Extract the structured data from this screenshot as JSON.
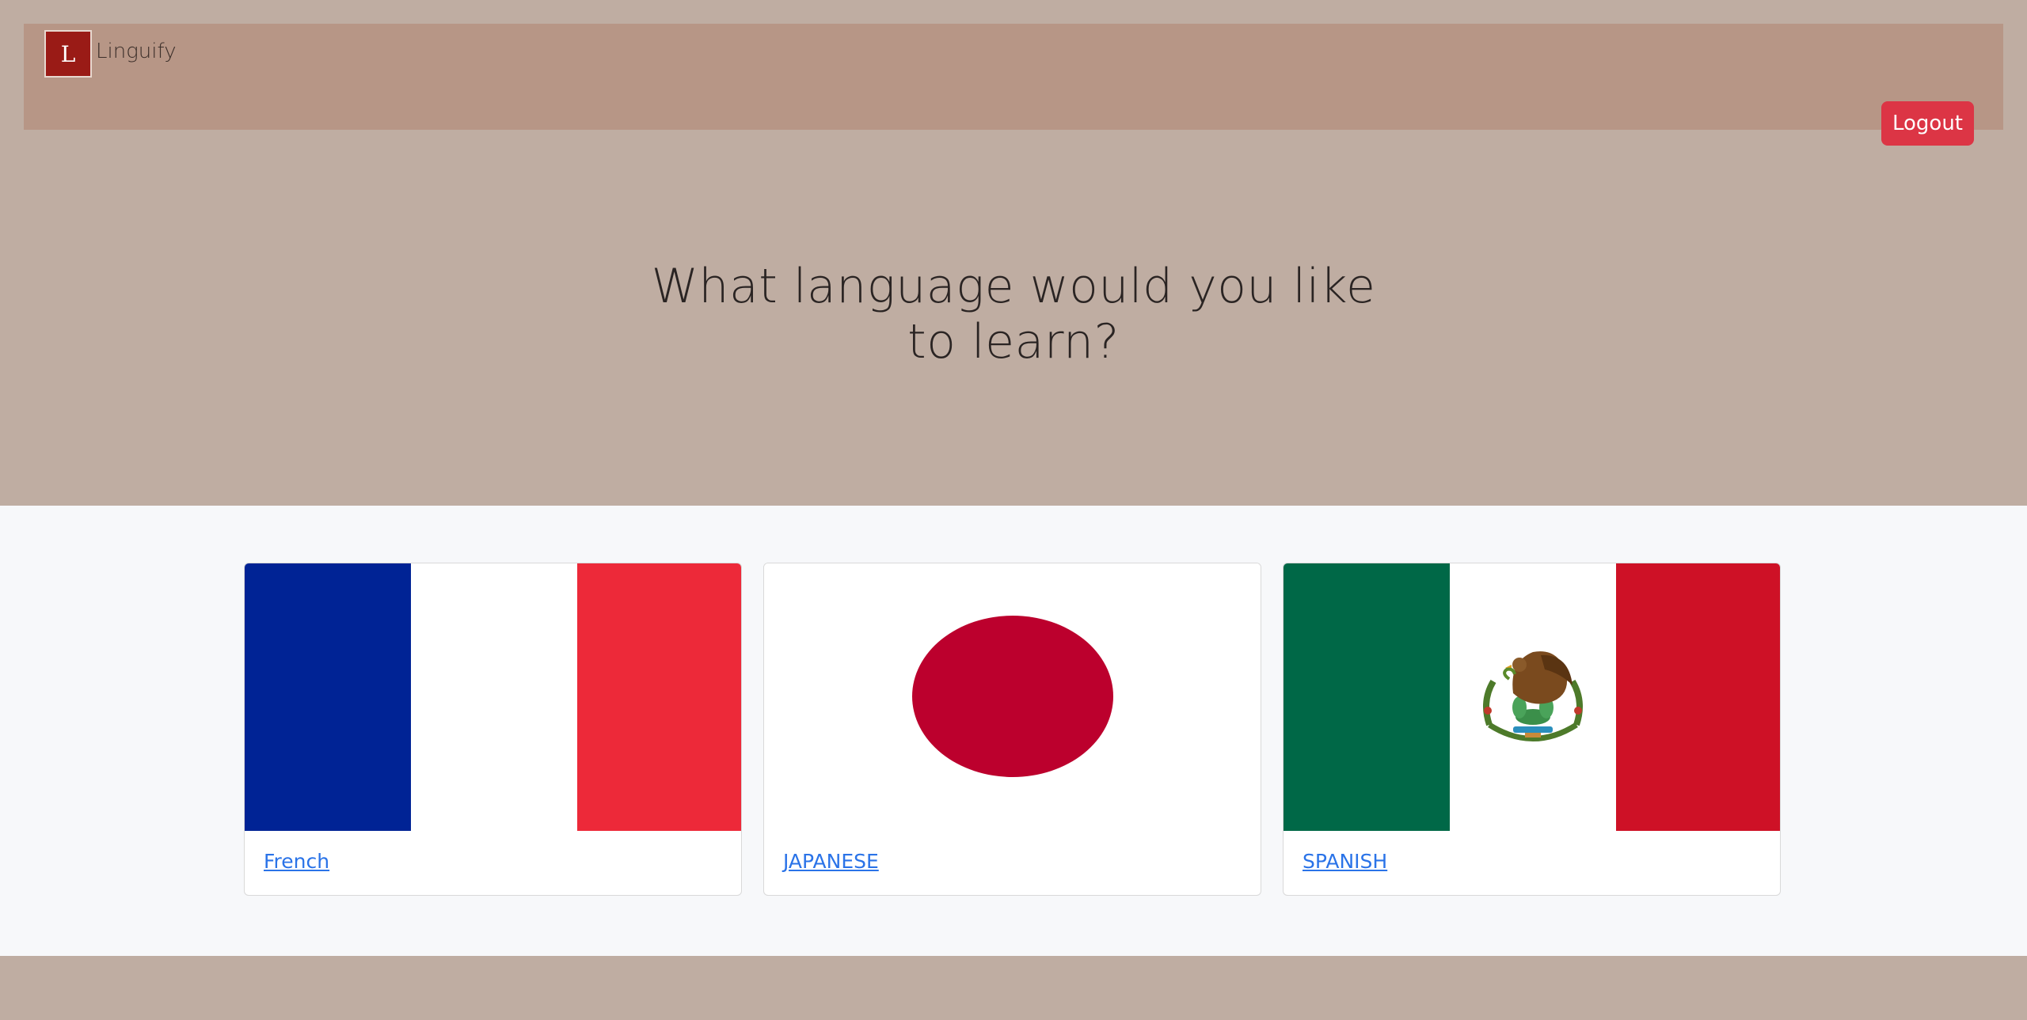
{
  "navbar": {
    "logo_letter": "L",
    "brand": "Linguify",
    "logout_label": "Logout"
  },
  "hero": {
    "title": "What language would you like to learn?"
  },
  "languages": [
    {
      "label": "French",
      "flag": "france-flag",
      "colors": [
        "#002395",
        "#ffffff",
        "#ed2939"
      ]
    },
    {
      "label": "JAPANESE",
      "flag": "japan-flag",
      "colors": [
        "#ffffff",
        "#bc002d"
      ]
    },
    {
      "label": "SPANISH",
      "flag": "mexico-flag",
      "colors": [
        "#006847",
        "#ffffff",
        "#ce1126"
      ]
    }
  ]
}
